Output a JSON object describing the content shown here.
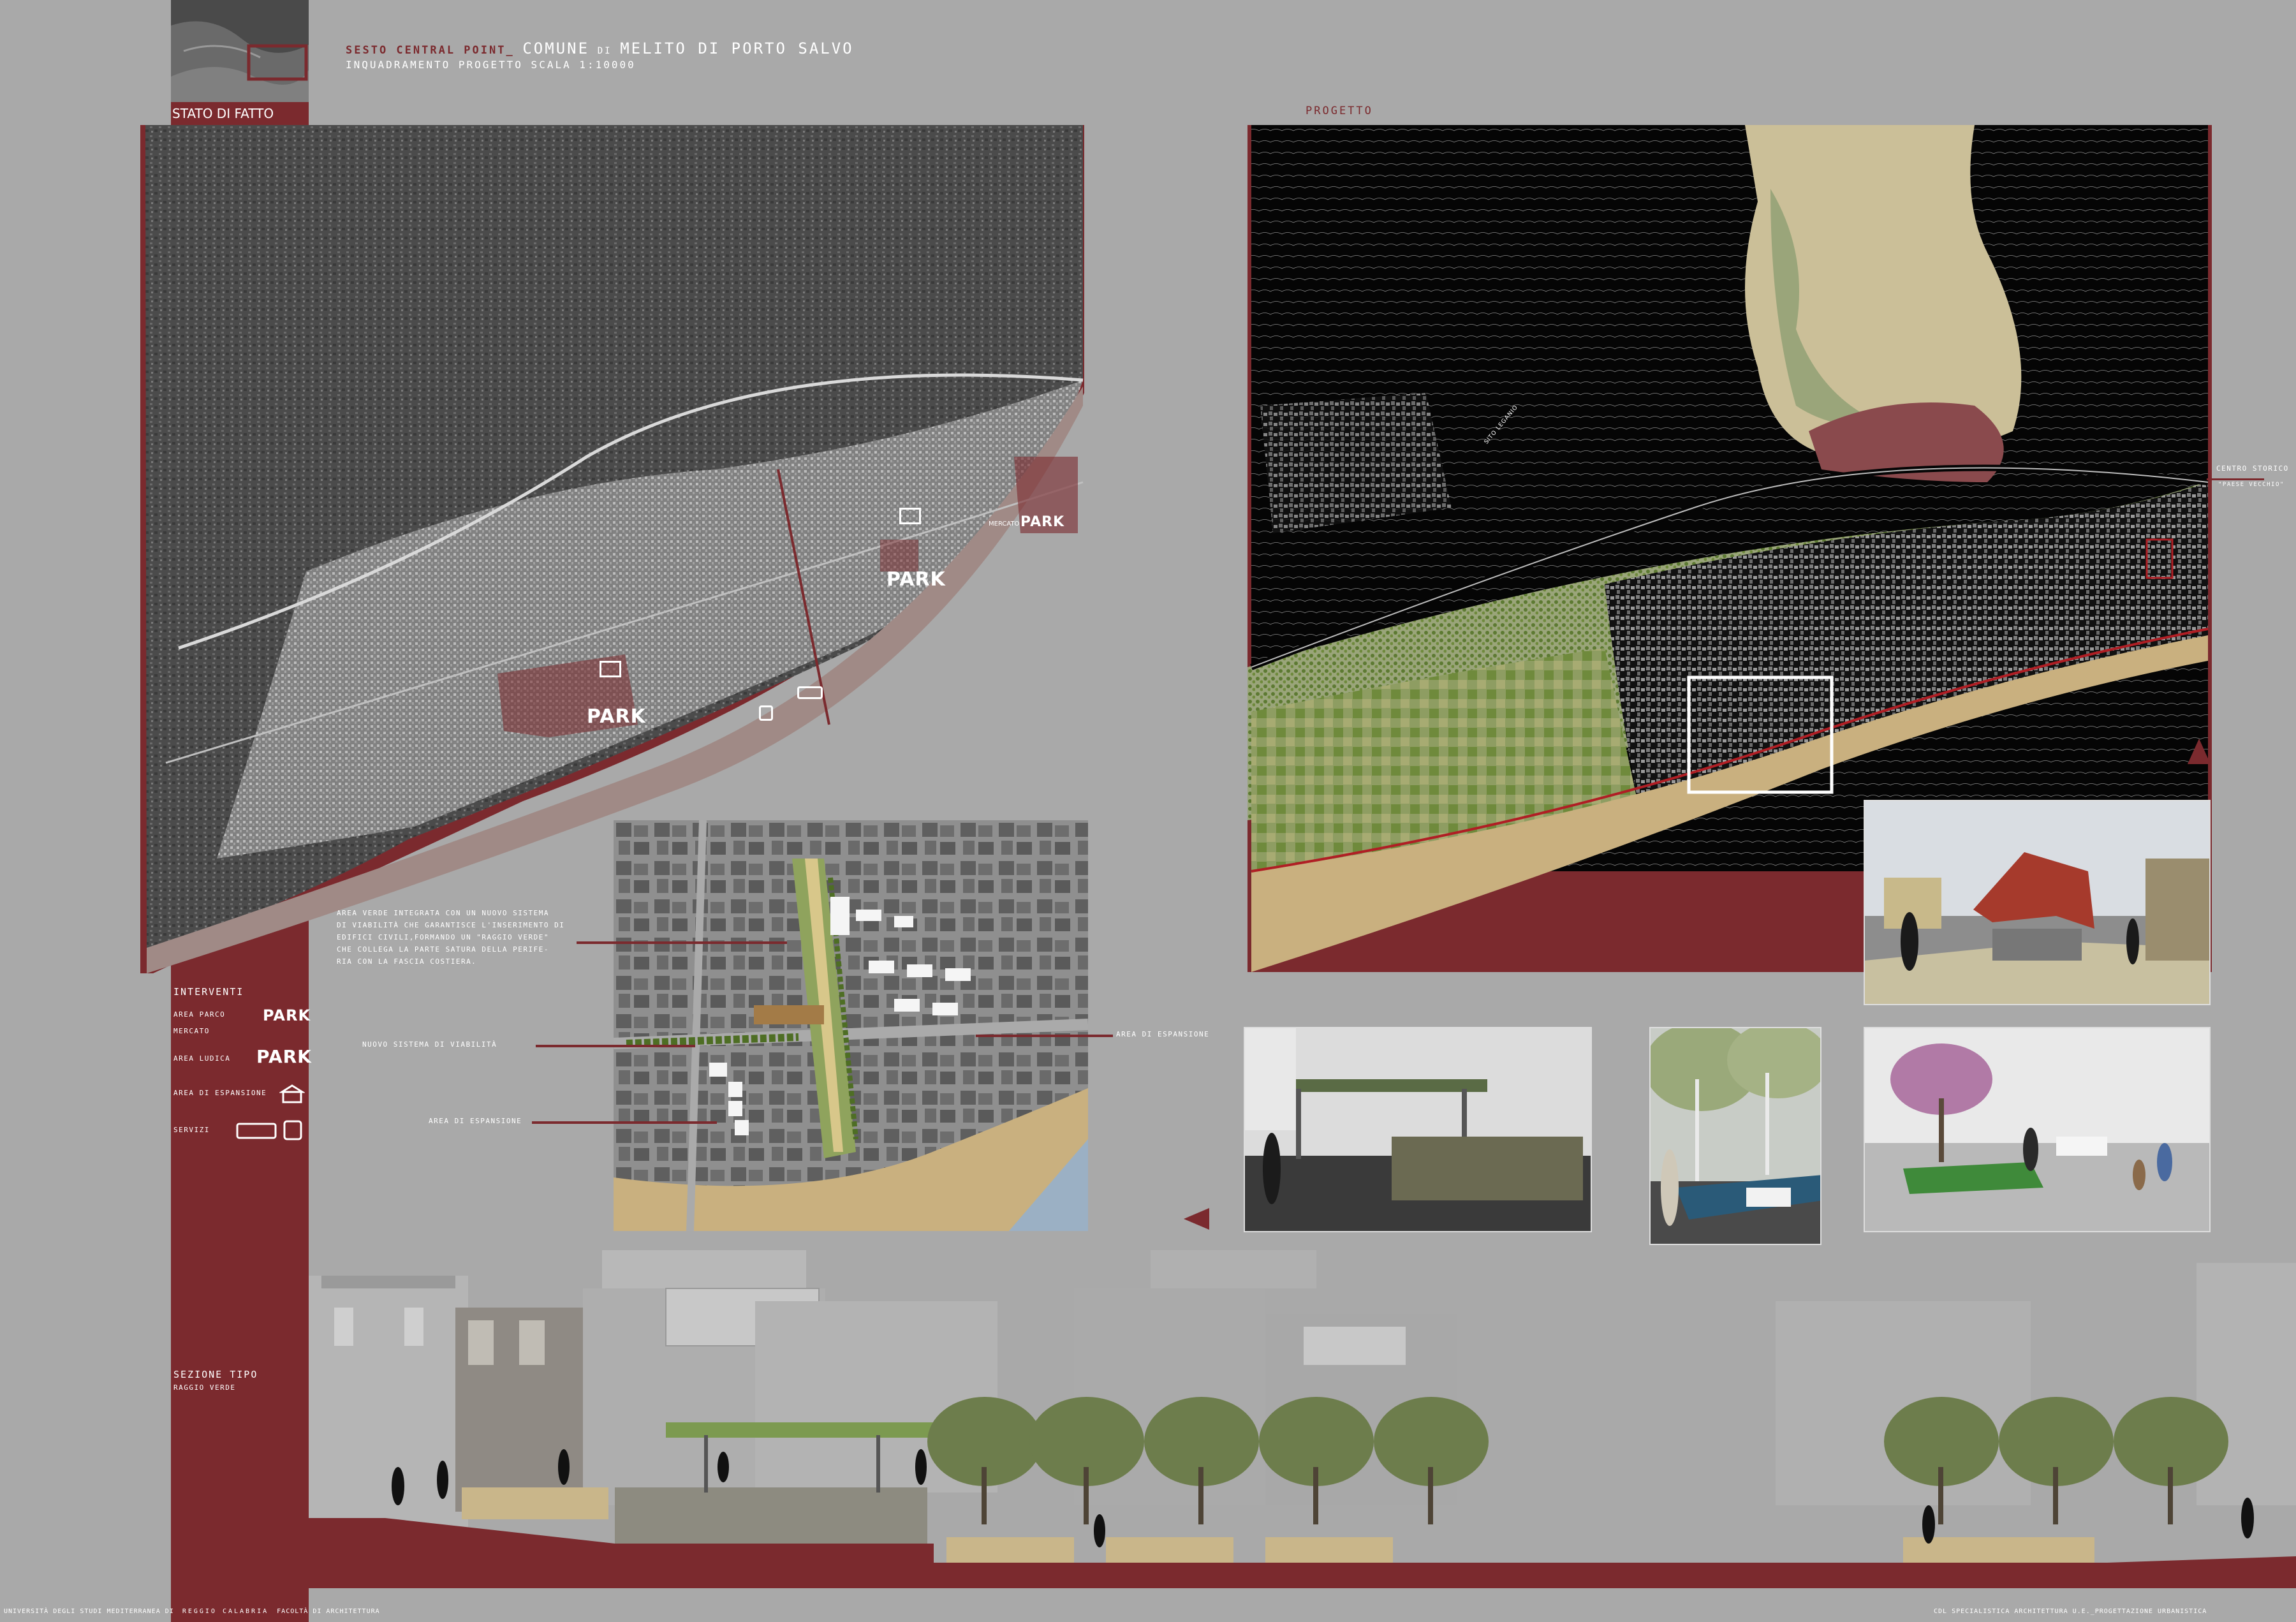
{
  "header": {
    "project": "SESTO CENTRAL POINT_",
    "comune_word": "COMUNE",
    "di_word": "DI",
    "place": "MELITO DI PORTO SALVO",
    "subtitle": "INQUADRAMENTO PROGETTO SCALA 1:10000"
  },
  "sidebar": {
    "stato_di_fatto": "STATO DI FATTO",
    "interventi_title": "INTERVENTI",
    "legend": [
      {
        "label": "AREA PARCO MERCATO",
        "icon": "park-market-icon",
        "badge": "PARK"
      },
      {
        "label": "AREA LUDICA",
        "icon": "park-icon",
        "badge": "PARK"
      },
      {
        "label": "AREA DI ESPANSIONE",
        "icon": "house-icon"
      },
      {
        "label": "SERVIZI",
        "icon": "bus-train-icon"
      }
    ],
    "sezione_title": "SEZIONE TIPO",
    "sezione_sub": "RAGGIO VERDE"
  },
  "maps": {
    "progetto_label": "PROGETTO",
    "park_badge": "PARK",
    "mercato_badge": "MERCATO",
    "centro_storico": "CENTRO STORICO",
    "paese_vecchio": "\"PAESE VECCHIO\"",
    "sito_label": "SITO LEGANIO"
  },
  "detail": {
    "caption_lines": [
      "AREA VERDE INTEGRATA CON UN NUOVO SISTEMA",
      "DI VIABILITÀ CHE GARANTISCE L'INSERIMENTO DI",
      "EDIFICI CIVILI,FORMANDO UN \"RAGGIO VERDE\"",
      "CHE COLLEGA LA PARTE SATURA DELLA PERIFE-",
      "RIA CON LA FASCIA COSTIERA."
    ],
    "viabilita_label": "NUOVO SISTEMA DI VIABILITÀ",
    "espansione_left": "AREA DI ESPANSIONE",
    "espansione_right": "AREA DI ESPANSIONE"
  },
  "footer": {
    "left_a": "UNIVERSITÀ DEGLI STUDI MEDITERRANEA DI",
    "left_b": "REGGIO CALABRIA",
    "left_c": "FACOLTÀ DI ARCHITETTURA",
    "right": "CDL SPECIALISTICA ARCHITETTURA U.E._PROGETTAZIONE URBANISTICA"
  },
  "colors": {
    "maroon": "#7b2a2e",
    "background": "#a9a9a9",
    "sand": "#c9b07f",
    "green": "#6f8a3c"
  }
}
